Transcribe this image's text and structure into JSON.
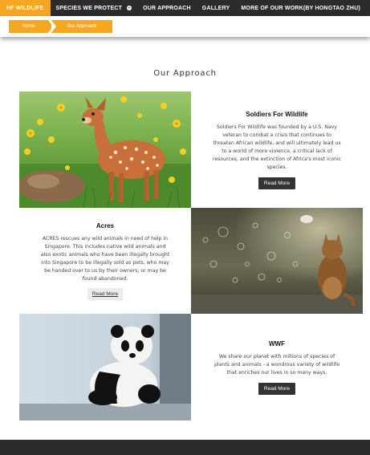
{
  "nav": {
    "brand": "HF WILDLIFE",
    "items": [
      {
        "label": "SPECIES WE PROTECT"
      },
      {
        "label": "OUR APPROACH"
      },
      {
        "label": "GALLERY"
      },
      {
        "label": "MORE OF OUR WORK(BY HONGTAO ZHU)"
      }
    ]
  },
  "breadcrumb": {
    "home": "Home",
    "current": "Our Approach"
  },
  "page": {
    "title": "Our Approach"
  },
  "cards": [
    {
      "title": "Soldiers For Wildlife",
      "description": "Soldiers For Wildlife was founded by a U.S. Navy veteran to combat a crisis that continues to threaten African wildlife, and will ultimately lead us to a world of more violence, a critical lack of resources, and the extinction of Africa's most iconic species.",
      "button": "Read More",
      "image": "fawn-in-meadow"
    },
    {
      "title": "Acres",
      "description": "ACRES rescues any wild animals in need of help in Singapore. This includes native wild animals and also exotic animals who have been illegally brought into Singapore to be illegally sold as pets, who may be handed over to us by their owners, or may be found abandoned.",
      "button": "Read More",
      "image": "kitten-with-bubbles"
    },
    {
      "title": "WWF",
      "description": "We share our planet with millions of species of plants and animals - a wondrous variety of wildlife that enriches our lives in so many ways.",
      "button": "Read More",
      "image": "panda-cub"
    }
  ],
  "colors": {
    "accent": "#f5a623",
    "nav_bg": "#2b2b2b",
    "button_dark": "#333333"
  }
}
